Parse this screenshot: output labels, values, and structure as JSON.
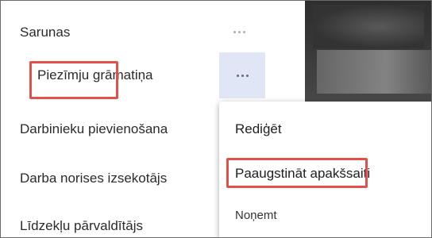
{
  "nav": {
    "items": [
      {
        "label": "Sarunas",
        "more_label": "···"
      },
      {
        "label": "Piezīmju grāmatiņa",
        "more_label": "···"
      },
      {
        "label": "Darbinieku pievienošana"
      },
      {
        "label": "Darba norises izsekotājs"
      },
      {
        "label": "Līdzekļu pārvaldītājs"
      }
    ]
  },
  "context_menu": {
    "items": [
      {
        "label": "Rediģēt"
      },
      {
        "label": "Paaugstināt apakšsaiti"
      },
      {
        "label": "Noņemt"
      }
    ]
  },
  "colors": {
    "highlight_border": "#e2504c",
    "active_button_bg": "#e1e6f7",
    "text": "#2b2b2b"
  }
}
